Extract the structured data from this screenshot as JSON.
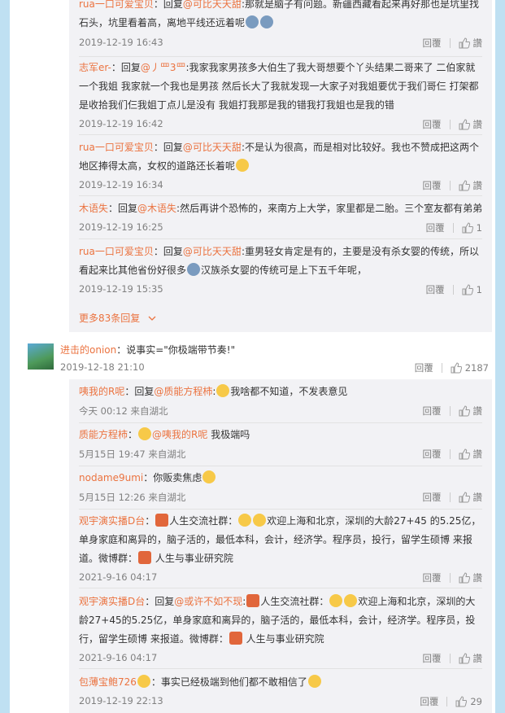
{
  "top_replies": [
    {
      "user": "rua一口可爱宝贝",
      "prefix": "：回复",
      "mention": "@可比天天甜",
      "sep": ":",
      "text": "那就是脑子有问题。新疆西藏看起来再好那也是坑里找石头，坑里看着高，离地平线还远着呢",
      "date": "2019-12-19 16:43",
      "reply": "回覆",
      "like": "讚"
    },
    {
      "user": "志军er-",
      "prefix": "：回复",
      "mention": "@丿罒3罒",
      "sep": ":",
      "text": "我家我家男孩多大伯生了我大哥想要个丫头结果二哥来了 二伯家就一个我姐 我家就一个我也是男孩 然后长大了我就发现一大家子对我姐要优于我们哥仨 打架都是收拾我们仨我姐丁点儿是没有 我姐打我那是我的错我打我姐也是我的错",
      "date": "2019-12-19 16:42",
      "reply": "回覆",
      "like": "讚"
    },
    {
      "user": "rua一口可爱宝贝",
      "prefix": "：回复",
      "mention": "@可比天天甜",
      "sep": ":",
      "text": "不是认为很高，而是相对比较好。我也不赞成把这两个地区捧得太高，女权的道路还长着呢",
      "date": "2019-12-19 16:34",
      "reply": "回覆",
      "like": "讚"
    },
    {
      "user": "木语失",
      "prefix": "：回复",
      "mention": "@木语失",
      "sep": ":",
      "text": "然后再讲个恐怖的，来南方上大学，家里都是二胎。三个室友都有弟弟",
      "date": "2019-12-19 16:25",
      "reply": "回覆",
      "like": "1"
    },
    {
      "user": "rua一口可爱宝贝",
      "prefix": "：回复",
      "mention": "@可比天天甜",
      "sep": ":",
      "text": "重男轻女肯定是有的，主要是没有杀女婴的传统，所以看起来比其他省份好很多",
      "text2": "汉族杀女婴的传统可是上下五千年呢，",
      "date": "2019-12-19 15:35",
      "reply": "回覆",
      "like": "1"
    }
  ],
  "more_replies": "更多83条回复",
  "main_comment": {
    "user": "进击的onion",
    "text": "：说事实=\"你极端带节奏!\"",
    "date": "2019-12-18 21:10",
    "reply": "回覆",
    "like": "2187"
  },
  "sub_replies": [
    {
      "user": "咦我的R呢",
      "prefix": "：回复",
      "mention": "@质能方程柿",
      "sep": ":",
      "text": "我啥都不知道，不发表意见",
      "date": "今天 00:12 来自湖北",
      "reply": "回覆",
      "like": "讚"
    },
    {
      "user": "质能方程柿",
      "prefix": "：",
      "mention": "@咦我的R呢",
      "sep": "",
      "text": " 我极端吗",
      "date": "5月15日 19:47 来自湖北",
      "reply": "回覆",
      "like": "讚"
    },
    {
      "user": "nodame9umi",
      "prefix": "：",
      "mention": "",
      "sep": "",
      "text": "你贩卖焦虑",
      "date": "5月15日 12:26 来自湖北",
      "reply": "回覆",
      "like": "讚"
    },
    {
      "user": "观宇演实播D台",
      "prefix": "：",
      "mention": "",
      "sep": "",
      "text": "人生交流社群：",
      "text2": "欢迎上海和北京，深圳的大龄27+45 的5.25亿，单身家庭和离异的，脑子活的，最低本科，会计，经济学。程序员，投行，留学生硕博 来报道。微博群：",
      "text3": "人生与事业研究院",
      "date": "2021-9-16 04:17",
      "reply": "回覆",
      "like": "讚"
    },
    {
      "user": "观宇演实播D台",
      "prefix": "：回复",
      "mention": "@或许不如不现",
      "sep": ":",
      "text": "人生交流社群：",
      "text2": "欢迎上海和北京，深圳的大龄27+45的5.25亿，单身家庭和离异的，脑子活的，最低本科，会计，经济学。程序员，投行，留学生硕博 来报道。微博群：",
      "text3": "人生与事业研究院",
      "date": "2021-9-16 04:17",
      "reply": "回覆",
      "like": "讚"
    },
    {
      "user": "包薄宝鲍726",
      "prefix": "：",
      "mention": "",
      "sep": "",
      "text": "事实已经极端到他们都不敢相信了",
      "date": "2019-12-19 22:13",
      "reply": "回覆",
      "like": "29"
    }
  ]
}
